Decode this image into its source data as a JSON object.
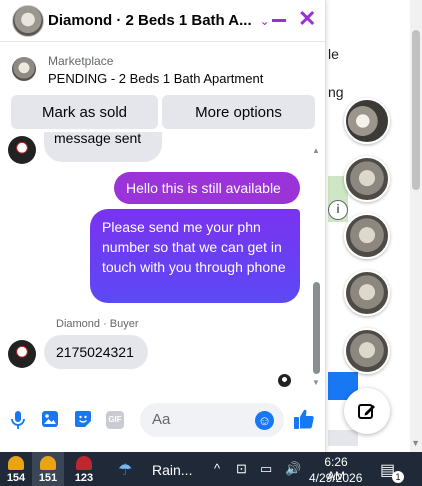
{
  "background_page": {
    "text_fragment_1": "le",
    "text_fragment_2": "ng",
    "info_icon": "i"
  },
  "chat": {
    "header": {
      "title": "Diamond · 2 Beds 1 Bath A...",
      "chevron": "⌄",
      "close": "✕"
    },
    "marketplace": {
      "label": "Marketplace",
      "listing_title": "PENDING - 2 Beds 1 Bath Apartment"
    },
    "buttons": {
      "mark_sold": "Mark as sold",
      "more_options": "More options"
    },
    "messages": {
      "partial_incoming": "message sent",
      "out_1": "Hello this is still available",
      "out_2": "Please send me your phn number so that we can get in touch with you through phone",
      "sender_label": "Diamond · Buyer",
      "incoming_phone": "2175024321"
    },
    "composer": {
      "placeholder": "Aa",
      "icons": [
        "microphone-icon",
        "photo-icon",
        "sticker-icon",
        "gif-icon",
        "emoji-icon",
        "thumbs-up-icon"
      ],
      "gif_label": "GIF"
    }
  },
  "chat_heads_count": 5,
  "taskbar": {
    "badge_1": "154",
    "badge_2": "151",
    "badge_3": "123",
    "weather": "Rain...",
    "time": "6:26 AM",
    "date": "4/29/2026",
    "notification_count": "1"
  },
  "colors": {
    "accent_purple": "#9b2fd6",
    "outgoing_gradient_top": "#7a33ef",
    "outgoing_gradient_bottom": "#5b49f5",
    "messenger_blue": "#1877f2",
    "taskbar_bg": "#1f2937"
  }
}
